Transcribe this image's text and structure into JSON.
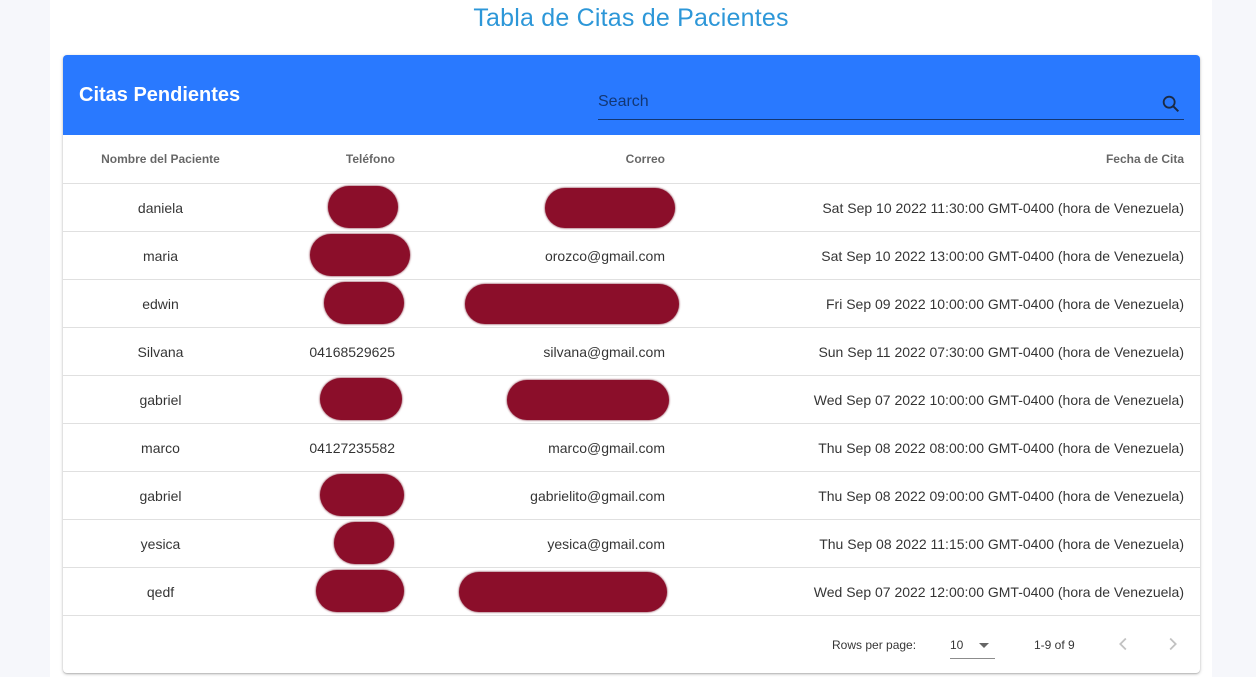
{
  "page": {
    "title": "Tabla de Citas de Pacientes"
  },
  "card": {
    "title": "Citas Pendientes",
    "search": {
      "placeholder": "Search",
      "value": ""
    },
    "columns": [
      "Nombre del Paciente",
      "Teléfono",
      "Correo",
      "Fecha de Cita"
    ],
    "rows": [
      {
        "name": "daniela",
        "phone": "",
        "email": "",
        "date": "Sat Sep 10 2022 11:30:00 GMT-0400 (hora de Venezuela)"
      },
      {
        "name": "maria",
        "phone": "",
        "email": "orozco@gmail.com",
        "date": "Sat Sep 10 2022 13:00:00 GMT-0400 (hora de Venezuela)"
      },
      {
        "name": "edwin",
        "phone": "",
        "email": "",
        "date": "Fri Sep 09 2022 10:00:00 GMT-0400 (hora de Venezuela)"
      },
      {
        "name": "Silvana",
        "phone": "04168529625",
        "email": "silvana@gmail.com",
        "date": "Sun Sep 11 2022 07:30:00 GMT-0400 (hora de Venezuela)"
      },
      {
        "name": "gabriel",
        "phone": "",
        "email": "",
        "date": "Wed Sep 07 2022 10:00:00 GMT-0400 (hora de Venezuela)"
      },
      {
        "name": "marco",
        "phone": "04127235582",
        "email": "marco@gmail.com",
        "date": "Thu Sep 08 2022 08:00:00 GMT-0400 (hora de Venezuela)"
      },
      {
        "name": "gabriel",
        "phone": "",
        "email": "gabrielito@gmail.com",
        "date": "Thu Sep 08 2022 09:00:00 GMT-0400 (hora de Venezuela)"
      },
      {
        "name": "yesica",
        "phone": "",
        "email": "yesica@gmail.com",
        "date": "Thu Sep 08 2022 11:15:00 GMT-0400 (hora de Venezuela)"
      },
      {
        "name": "qedf",
        "phone": "",
        "email": "",
        "date": "Wed Sep 07 2022 12:00:00 GMT-0400 (hora de Venezuela)"
      }
    ]
  },
  "pagination": {
    "rows_per_page_label": "Rows per page:",
    "rows_per_page_value": "10",
    "range": "1-9 of 9"
  },
  "colors": {
    "header": "#2979ff",
    "title": "#2d97d8",
    "redaction": "#8b0e2a"
  },
  "icons": {
    "search": "search-icon",
    "prev": "chevron-left-icon",
    "next": "chevron-right-icon",
    "select": "chevron-down-icon"
  }
}
